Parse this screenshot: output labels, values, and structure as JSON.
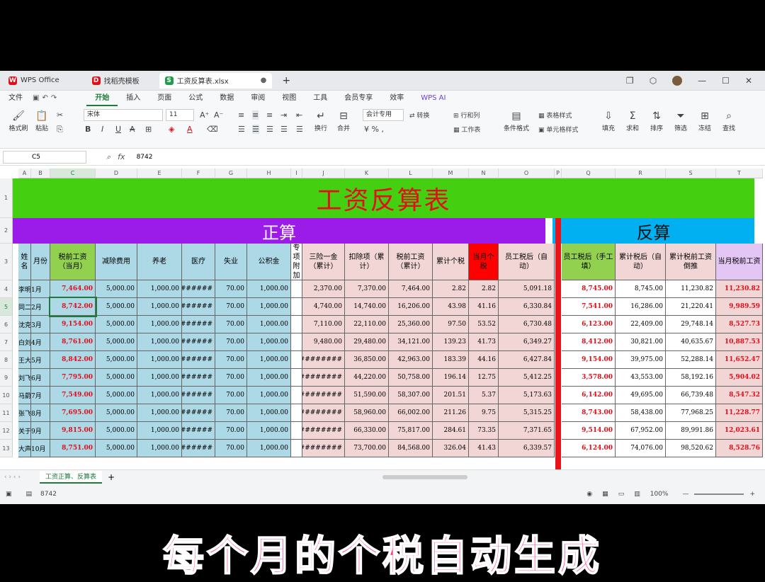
{
  "tabs": [
    {
      "label": "WPS Office",
      "color": "#e0101a"
    },
    {
      "label": "找稻壳模板",
      "color": "#e0101a"
    },
    {
      "label": "工资反算表.xlsx",
      "color": "#1f9d4a"
    }
  ],
  "menu": [
    "文件",
    "开始",
    "插入",
    "页面",
    "公式",
    "数据",
    "审阅",
    "视图",
    "工具",
    "会员专享",
    "效率",
    "WPS AI"
  ],
  "menu_active": "开始",
  "ribbon": {
    "format_painter": "格式刷",
    "paste": "粘贴",
    "font_name": "宋体",
    "font_size": "11",
    "wrap": "换行",
    "merge": "合并",
    "number_format": "会计专用",
    "convert": "转换",
    "row_col": "行和列",
    "worksheet": "工作表",
    "cond_format": "条件格式",
    "table_style": "表格样式",
    "cell_style": "单元格样式",
    "fill": "填充",
    "sum": "求和",
    "sort": "排序",
    "filter": "筛选",
    "freeze": "冻结",
    "find": "查找"
  },
  "formula_bar": {
    "cell_ref": "C5",
    "fx": "fx",
    "value": "8742"
  },
  "columns": [
    "A",
    "B",
    "C",
    "D",
    "E",
    "F",
    "G",
    "H",
    "I",
    "J",
    "K",
    "L",
    "M",
    "N",
    "O",
    "P",
    "Q",
    "R",
    "S",
    "T"
  ],
  "selected_col": "C",
  "sheet": {
    "title": "工资反算表",
    "band_forward": "正算",
    "band_reverse": "反算",
    "headers": [
      "姓名",
      "月份",
      "税前工资（当月）",
      "减除费用",
      "养老",
      "医疗",
      "失业",
      "公积金",
      "专项附加",
      "三险一金（累计）",
      "扣除项（累计）",
      "税前工资（累计）",
      "累计个税",
      "当月个税",
      "员工税后（自动）",
      "",
      "员工税后（手工填）",
      "累计税后（自动）",
      "累计税前工资倒推",
      "当月税前工资"
    ],
    "rows": [
      {
        "r": "4",
        "name": "李明",
        "month": "1月",
        "pre": "7,464.00",
        "ded": "5,000.00",
        "pen": "1,000.00",
        "med": "######",
        "une": "70.00",
        "fund": "1,000.00",
        "ins": "2,370.00",
        "dedc": "7,370.00",
        "prec": "7,464.00",
        "taxc": "2.82",
        "taxm": "2.82",
        "netauto": "5,091.18",
        "netman": "8,745.00",
        "netc": "8,745.00",
        "prerev": "11,230.82",
        "premonth": "11,230.82"
      },
      {
        "r": "5",
        "name": "同二",
        "month": "2月",
        "pre": "8,742.00",
        "ded": "5,000.00",
        "pen": "1,000.00",
        "med": "#######",
        "une": "70.00",
        "fund": "1,000.00",
        "ins": "4,740.00",
        "dedc": "14,740.00",
        "prec": "16,206.00",
        "taxc": "43.98",
        "taxm": "41.16",
        "netauto": "6,330.84",
        "netman": "7,541.00",
        "netc": "16,286.00",
        "prerev": "21,220.41",
        "premonth": "9,989.59"
      },
      {
        "r": "6",
        "name": "沈克",
        "month": "3月",
        "pre": "9,154.00",
        "ded": "5,000.00",
        "pen": "1,000.00",
        "med": "#######",
        "une": "70.00",
        "fund": "1,000.00",
        "ins": "7,110.00",
        "dedc": "22,110.00",
        "prec": "25,360.00",
        "taxc": "97.50",
        "taxm": "53.52",
        "netauto": "6,730.48",
        "netman": "6,123.00",
        "netc": "22,409.00",
        "prerev": "29,748.14",
        "premonth": "8,527.73"
      },
      {
        "r": "7",
        "name": "白刘",
        "month": "4月",
        "pre": "8,761.00",
        "ded": "5,000.00",
        "pen": "1,000.00",
        "med": "#######",
        "une": "70.00",
        "fund": "1,000.00",
        "ins": "9,480.00",
        "dedc": "29,480.00",
        "prec": "34,121.00",
        "taxc": "139.23",
        "taxm": "41.73",
        "netauto": "6,349.27",
        "netman": "8,412.00",
        "netc": "30,821.00",
        "prerev": "40,635.67",
        "premonth": "10,887.53"
      },
      {
        "r": "8",
        "name": "王大",
        "month": "5月",
        "pre": "8,842.00",
        "ded": "5,000.00",
        "pen": "1,000.00",
        "med": "#######",
        "une": "70.00",
        "fund": "1,000.00",
        "ins": "##########",
        "dedc": "36,850.00",
        "prec": "42,963.00",
        "taxc": "183.39",
        "taxm": "44.16",
        "netauto": "6,427.84",
        "netman": "9,154.00",
        "netc": "39,975.00",
        "prerev": "52,288.14",
        "premonth": "11,652.47"
      },
      {
        "r": "9",
        "name": "刘飞",
        "month": "6月",
        "pre": "7,795.00",
        "ded": "5,000.00",
        "pen": "1,000.00",
        "med": "#######",
        "une": "70.00",
        "fund": "1,000.00",
        "ins": "##########",
        "dedc": "44,220.00",
        "prec": "50,758.00",
        "taxc": "196.14",
        "taxm": "12.75",
        "netauto": "5,412.25",
        "netman": "3,578.00",
        "netc": "43,553.00",
        "prerev": "58,192.16",
        "premonth": "5,904.02"
      },
      {
        "r": "10",
        "name": "马蔚",
        "month": "7月",
        "pre": "7,549.00",
        "ded": "5,000.00",
        "pen": "1,000.00",
        "med": "#######",
        "une": "70.00",
        "fund": "1,000.00",
        "ins": "##########",
        "dedc": "51,590.00",
        "prec": "58,307.00",
        "taxc": "201.51",
        "taxm": "5.37",
        "netauto": "5,173.63",
        "netman": "6,142.00",
        "netc": "49,695.00",
        "prerev": "66,739.48",
        "premonth": "8,547.32"
      },
      {
        "r": "11",
        "name": "张飞",
        "month": "8月",
        "pre": "7,695.00",
        "ded": "5,000.00",
        "pen": "1,000.00",
        "med": "#######",
        "une": "70.00",
        "fund": "1,000.00",
        "ins": "##########",
        "dedc": "58,960.00",
        "prec": "66,002.00",
        "taxc": "211.26",
        "taxm": "9.75",
        "netauto": "5,315.25",
        "netman": "8,743.00",
        "netc": "58,438.00",
        "prerev": "77,968.25",
        "premonth": "11,228.77"
      },
      {
        "r": "12",
        "name": "关于",
        "month": "9月",
        "pre": "9,815.00",
        "ded": "5,000.00",
        "pen": "1,000.00",
        "med": "#######",
        "une": "70.00",
        "fund": "1,000.00",
        "ins": "##########",
        "dedc": "66,330.00",
        "prec": "75,817.00",
        "taxc": "284.61",
        "taxm": "73.35",
        "netauto": "7,371.65",
        "netman": "9,514.00",
        "netc": "67,952.00",
        "prerev": "89,991.86",
        "premonth": "12,023.61"
      },
      {
        "r": "13",
        "name": "大声",
        "month": "10月",
        "pre": "8,751.00",
        "ded": "5,000.00",
        "pen": "1,000.00",
        "med": "#######",
        "une": "70.00",
        "fund": "1,000.00",
        "ins": "##########",
        "dedc": "73,700.00",
        "prec": "84,568.00",
        "taxc": "326.04",
        "taxm": "41.43",
        "netauto": "6,339.57",
        "netman": "6,124.00",
        "netc": "74,076.00",
        "prerev": "98,520.62",
        "premonth": "8,528.76"
      }
    ]
  },
  "sheet_tab": "工资正算、反算表",
  "status": {
    "value": "8742",
    "zoom": "100%"
  },
  "caption": "每个月的个税自动生成",
  "colors": {
    "title_bg": "#44d011",
    "forward_band": "#9b1ce8",
    "reverse_band": "#00b0f0",
    "blue_cols": "#add8e6",
    "pink_cols": "#f2d5d5",
    "input_green": "#92d050",
    "separator": "#e8141c",
    "tax_red": "#ff0000",
    "reverse_last": "#e4c6f5",
    "caption": "#ff3b8d"
  }
}
